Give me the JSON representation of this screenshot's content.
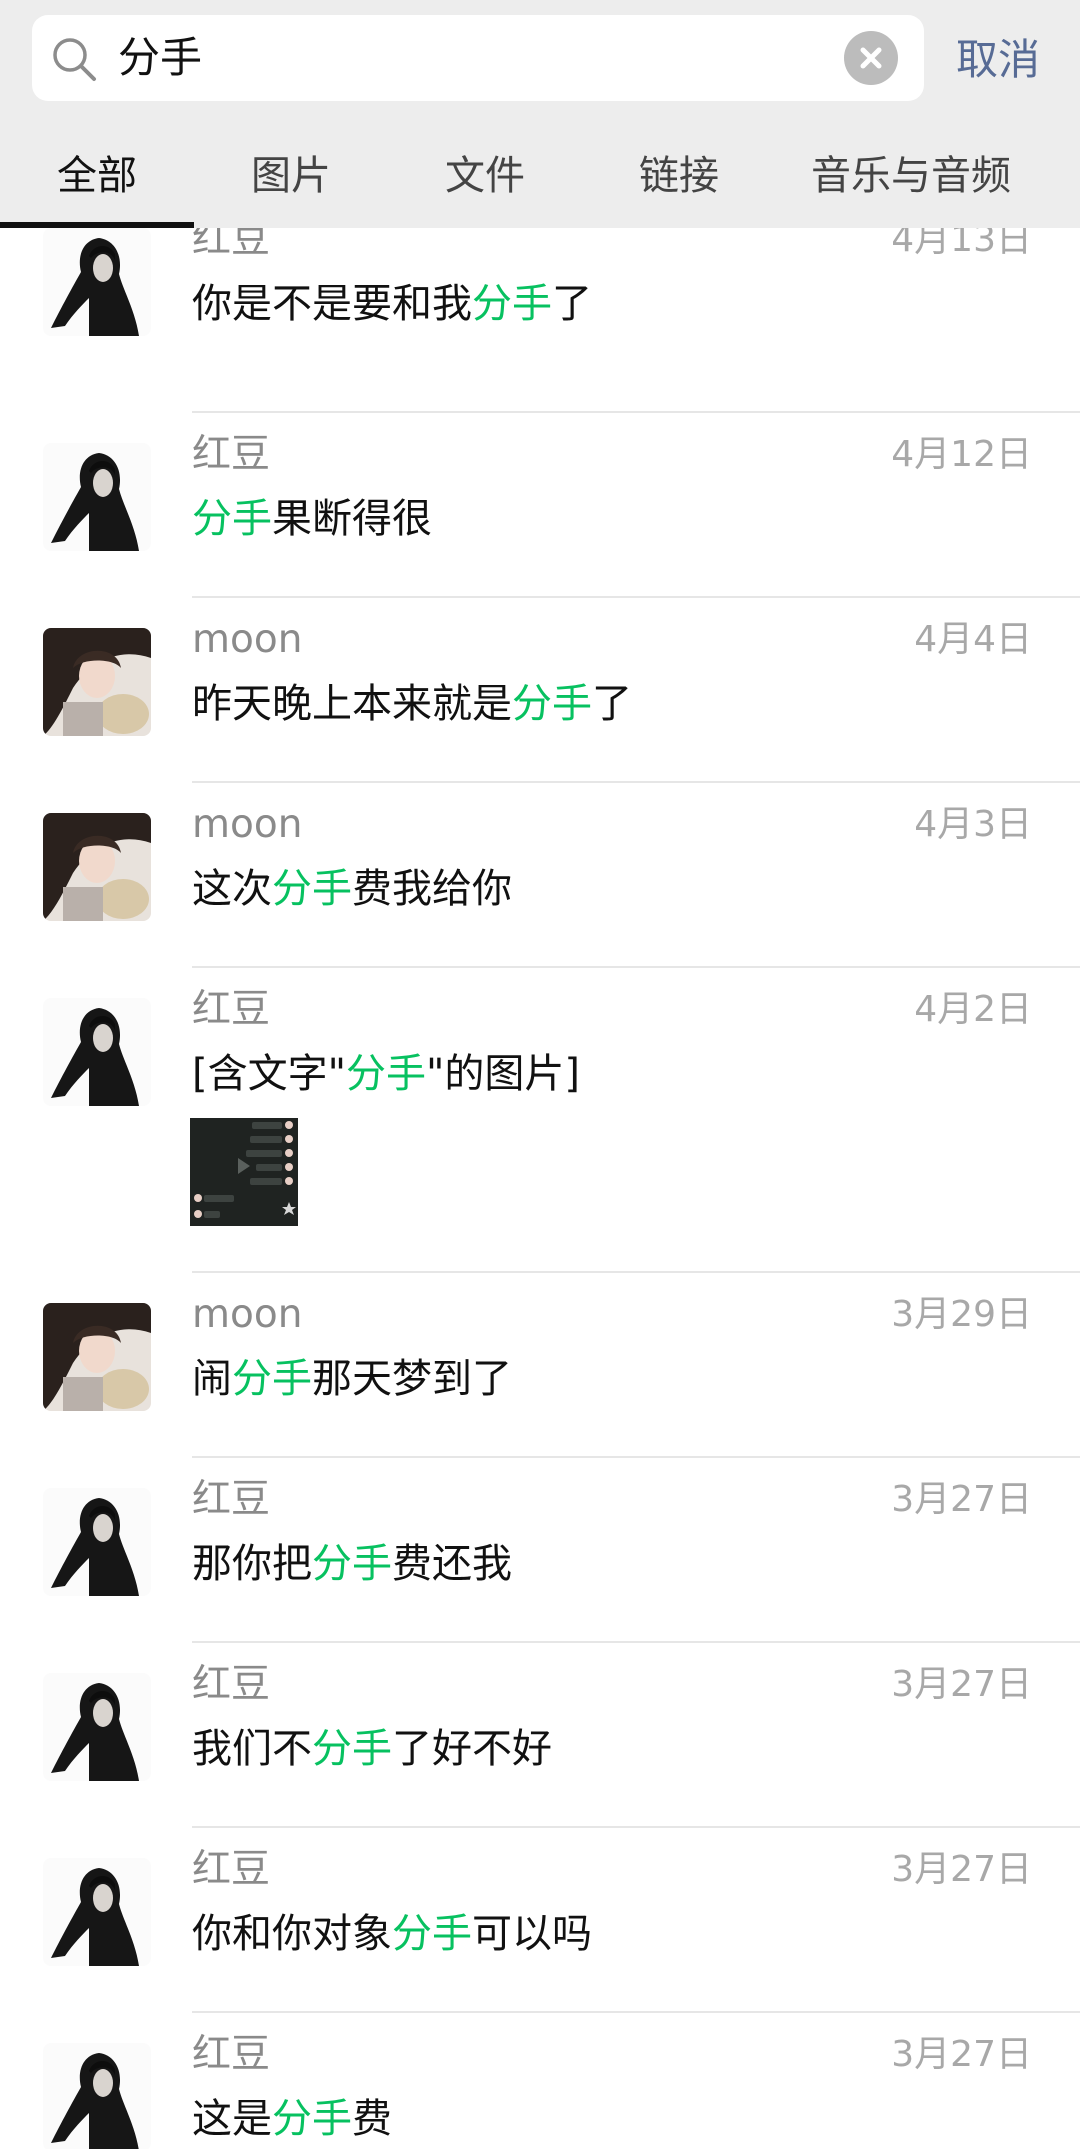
{
  "search": {
    "query": "分手",
    "cancel_label": "取消"
  },
  "tabs": [
    {
      "label": "全部",
      "active": true
    },
    {
      "label": "图片",
      "active": false
    },
    {
      "label": "文件",
      "active": false
    },
    {
      "label": "链接",
      "active": false
    },
    {
      "label": "音乐与音频",
      "active": false
    }
  ],
  "colors": {
    "highlight": "#07c160",
    "link": "#576b95",
    "header_bg": "#ededed"
  },
  "results": [
    {
      "sender": "红豆",
      "date": "4月13日",
      "avatar": "avatar-hongdou",
      "pre": "你是不是要和我",
      "keyword": "分手",
      "post": "了"
    },
    {
      "sender": "红豆",
      "date": "4月12日",
      "avatar": "avatar-hongdou",
      "pre": "",
      "keyword": "分手",
      "post": "果断得很"
    },
    {
      "sender": "moon",
      "date": "4月4日",
      "avatar": "avatar-moon",
      "pre": "昨天晚上本来就是",
      "keyword": "分手",
      "post": "了"
    },
    {
      "sender": "moon",
      "date": "4月3日",
      "avatar": "avatar-moon",
      "pre": "这次",
      "keyword": "分手",
      "post": "费我给你"
    },
    {
      "sender": "红豆",
      "date": "4月2日",
      "avatar": "avatar-hongdou",
      "pre": "[含文字\"",
      "keyword": "分手",
      "post": "\"的图片]",
      "has_image": true
    },
    {
      "sender": "moon",
      "date": "3月29日",
      "avatar": "avatar-moon",
      "pre": "闹",
      "keyword": "分手",
      "post": "那天梦到了"
    },
    {
      "sender": "红豆",
      "date": "3月27日",
      "avatar": "avatar-hongdou",
      "pre": "那你把",
      "keyword": "分手",
      "post": "费还我"
    },
    {
      "sender": "红豆",
      "date": "3月27日",
      "avatar": "avatar-hongdou",
      "pre": "我们不",
      "keyword": "分手",
      "post": "了好不好"
    },
    {
      "sender": "红豆",
      "date": "3月27日",
      "avatar": "avatar-hongdou",
      "pre": "你和你对象",
      "keyword": "分手",
      "post": "可以吗"
    },
    {
      "sender": "红豆",
      "date": "3月27日",
      "avatar": "avatar-hongdou",
      "pre": "这是",
      "keyword": "分手",
      "post": "费"
    }
  ]
}
